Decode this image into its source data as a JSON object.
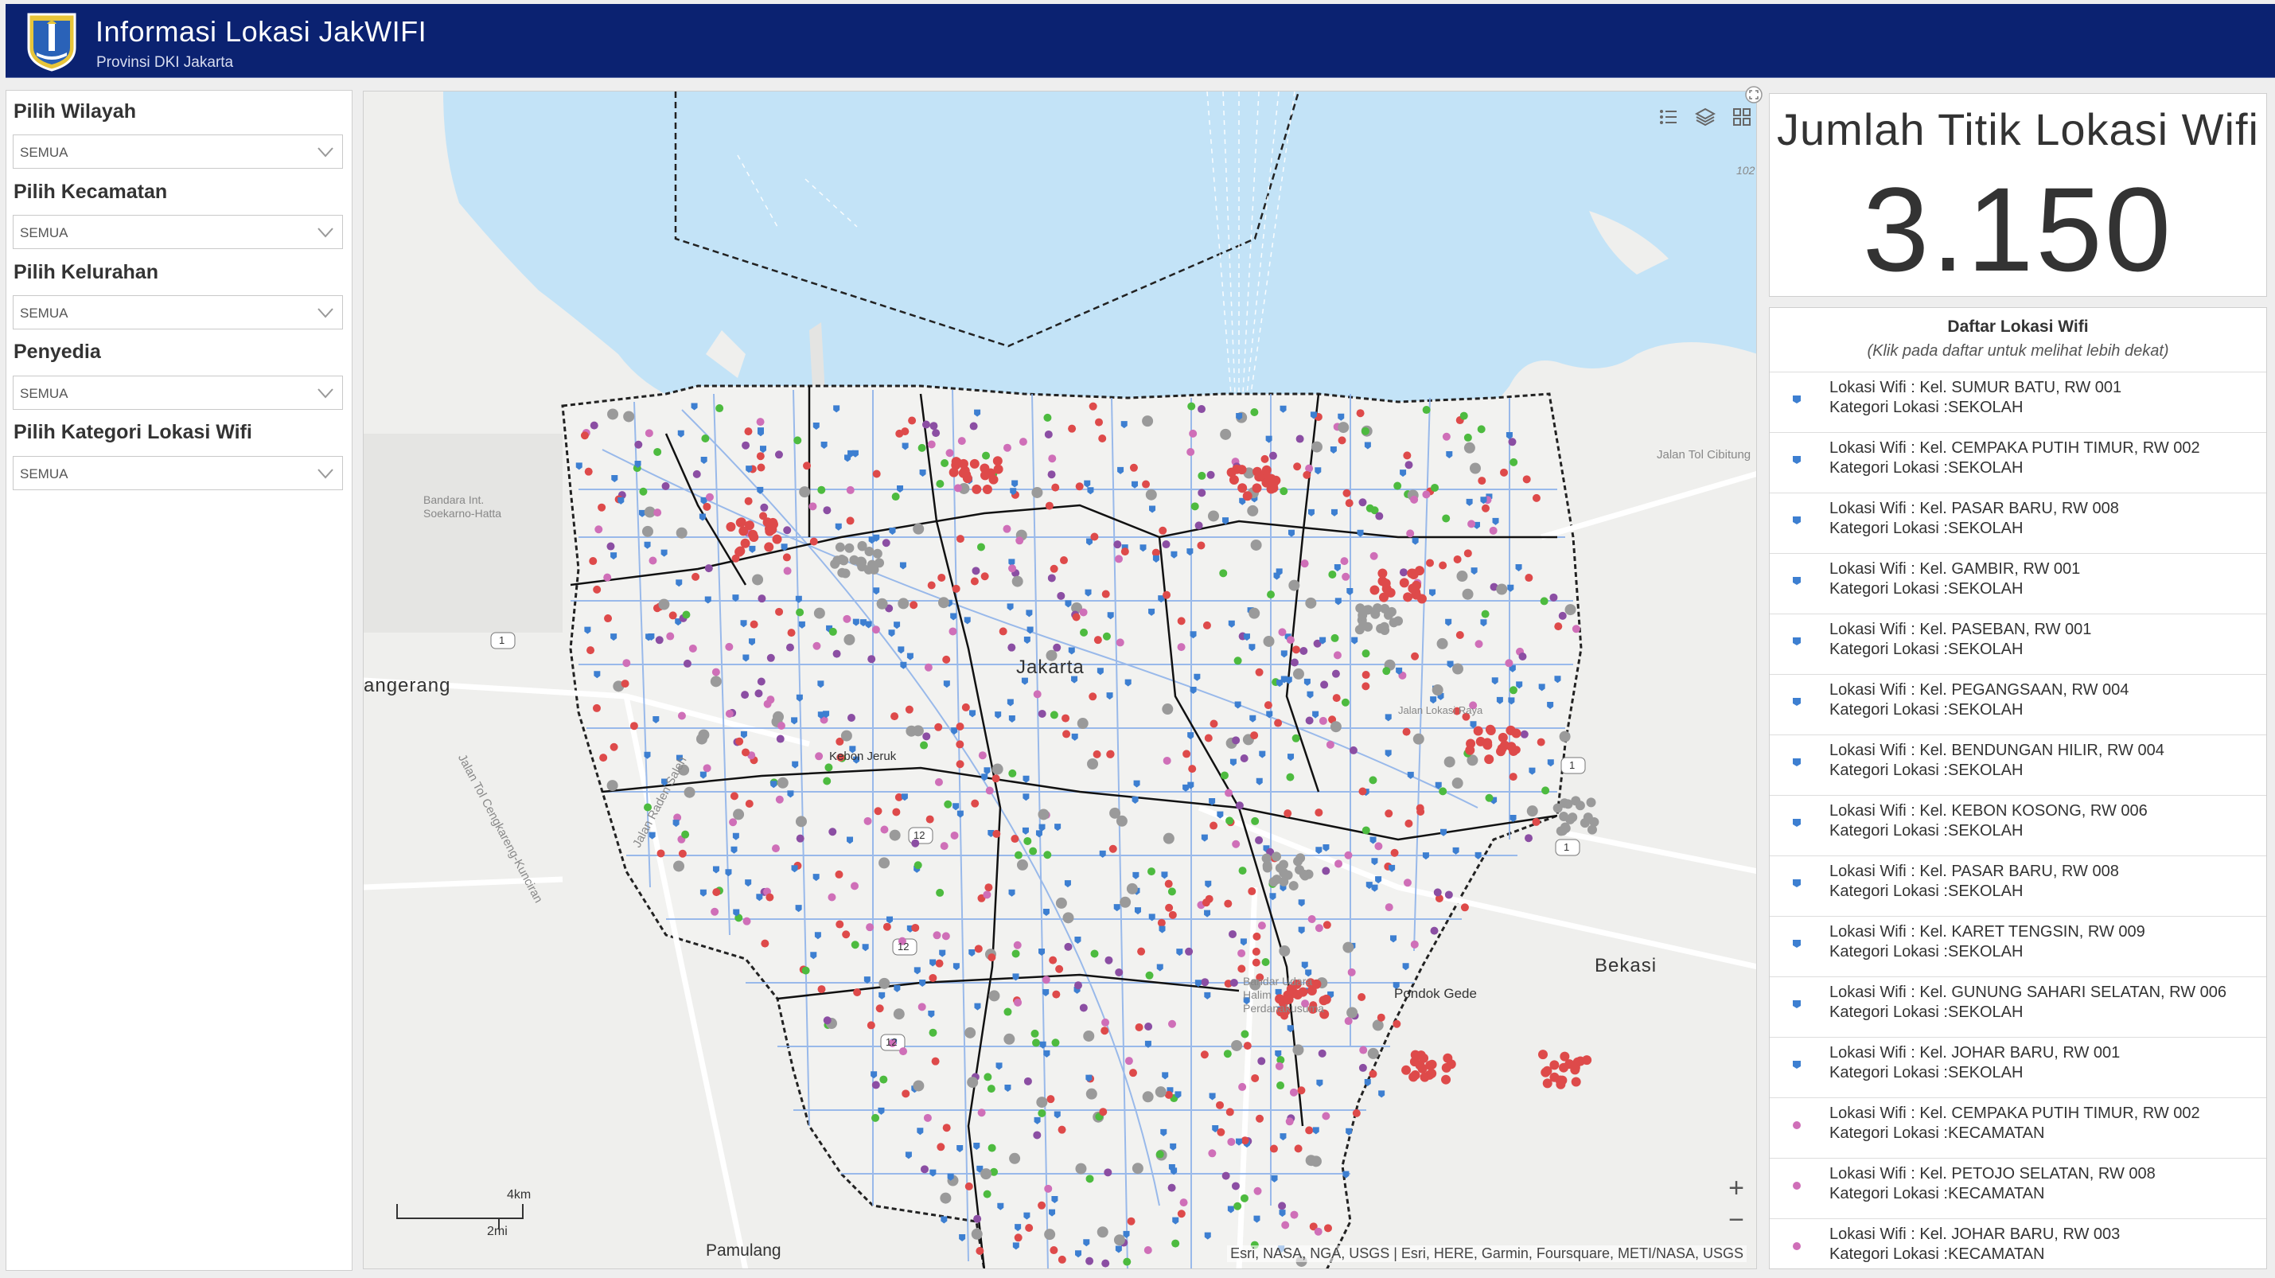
{
  "header": {
    "title": "Informasi Lokasi JakWIFI",
    "subtitle": "Provinsi DKI Jakarta"
  },
  "filters": [
    {
      "label": "Pilih Wilayah",
      "value": "SEMUA"
    },
    {
      "label": "Pilih Kecamatan",
      "value": "SEMUA"
    },
    {
      "label": "Pilih Kelurahan",
      "value": "SEMUA"
    },
    {
      "label": "Penyedia",
      "value": "SEMUA"
    },
    {
      "label": "Pilih Kategori Lokasi Wifi",
      "value": "SEMUA"
    }
  ],
  "map": {
    "places": {
      "tangerang": "angerang",
      "jakarta": "Jakarta",
      "bekasi": "Bekasi",
      "pamulang": "Pamulang",
      "pondok_gede": "Pondok Gede",
      "kebon_jeruk": "Kebon Jeruk",
      "airport": "Bandara Int. Soekarno-Hatta",
      "halim": "Bandar Udara Halim Perdanakusuma",
      "toll_cibitung": "Jalan Tol Cibitung",
      "toll_kunciran": "Jalan Tol Cengkareng-Kunciran",
      "raden_saleh": "Jalan Raden Saleh",
      "lokasi_raya": "Jalan Lokasi Raya",
      "edge_102": "102"
    },
    "road_shields": [
      "1",
      "1",
      "1",
      "12",
      "12",
      "12"
    ],
    "scale": {
      "km": "4km",
      "mi": "2mi"
    },
    "attribution": "Esri, NASA, NGA, USGS | Esri, HERE, Garmin, Foursquare, METI/NASA, USGS",
    "tools": [
      "legend-icon",
      "layers-icon",
      "basemap-gallery-icon"
    ],
    "zoom": {
      "in": "+",
      "out": "−"
    },
    "colors": {
      "water": "#c3e3f7",
      "land": "#efefed",
      "boundary": "#222222",
      "roads": "#8ab0ea",
      "school": "#3d7fd1",
      "kecamatan": "#cf6fb8",
      "red": "#de4a4a",
      "green": "#4dbb3f",
      "purple": "#8b4ea3",
      "gray": "#9a9a9a"
    }
  },
  "summary": {
    "title": "Jumlah Titik Lokasi Wifi",
    "value": "3.150"
  },
  "list": {
    "header": "Daftar Lokasi Wifi",
    "subheader": "(Klik pada daftar untuk melihat lebih dekat)",
    "items": [
      {
        "l1": "Lokasi Wifi :  Kel. SUMUR BATU, RW 001",
        "l2": "Kategori Lokasi :SEKOLAH",
        "type": "school"
      },
      {
        "l1": "Lokasi Wifi :  Kel. CEMPAKA PUTIH TIMUR, RW 002",
        "l2": "Kategori Lokasi :SEKOLAH",
        "type": "school"
      },
      {
        "l1": "Lokasi Wifi :  Kel. PASAR BARU, RW 008",
        "l2": "Kategori Lokasi :SEKOLAH",
        "type": "school"
      },
      {
        "l1": "Lokasi Wifi :  Kel. GAMBIR, RW 001",
        "l2": "Kategori Lokasi :SEKOLAH",
        "type": "school"
      },
      {
        "l1": "Lokasi Wifi :  Kel. PASEBAN, RW 001",
        "l2": "Kategori Lokasi :SEKOLAH",
        "type": "school"
      },
      {
        "l1": "Lokasi Wifi :  Kel. PEGANGSAAN, RW 004",
        "l2": "Kategori Lokasi :SEKOLAH",
        "type": "school"
      },
      {
        "l1": "Lokasi Wifi :  Kel. BENDUNGAN HILIR, RW 004",
        "l2": "Kategori Lokasi :SEKOLAH",
        "type": "school"
      },
      {
        "l1": "Lokasi Wifi :  Kel. KEBON KOSONG, RW 006",
        "l2": "Kategori Lokasi :SEKOLAH",
        "type": "school"
      },
      {
        "l1": "Lokasi Wifi :  Kel. PASAR BARU, RW 008",
        "l2": "Kategori Lokasi :SEKOLAH",
        "type": "school"
      },
      {
        "l1": "Lokasi Wifi :  Kel. KARET TENGSIN, RW 009",
        "l2": "Kategori Lokasi :SEKOLAH",
        "type": "school"
      },
      {
        "l1": "Lokasi Wifi :  Kel. GUNUNG SAHARI SELATAN, RW 006",
        "l2": "Kategori Lokasi :SEKOLAH",
        "type": "school"
      },
      {
        "l1": "Lokasi Wifi :  Kel. JOHAR BARU, RW 001",
        "l2": "Kategori Lokasi :SEKOLAH",
        "type": "school"
      },
      {
        "l1": "Lokasi Wifi :  Kel. CEMPAKA PUTIH TIMUR, RW 002",
        "l2": "Kategori Lokasi :KECAMATAN",
        "type": "kecamatan"
      },
      {
        "l1": "Lokasi Wifi :  Kel. PETOJO SELATAN, RW 008",
        "l2": "Kategori Lokasi :KECAMATAN",
        "type": "kecamatan"
      },
      {
        "l1": "Lokasi Wifi :  Kel. JOHAR BARU, RW 003",
        "l2": "Kategori Lokasi :KECAMATAN",
        "type": "kecamatan"
      }
    ]
  }
}
